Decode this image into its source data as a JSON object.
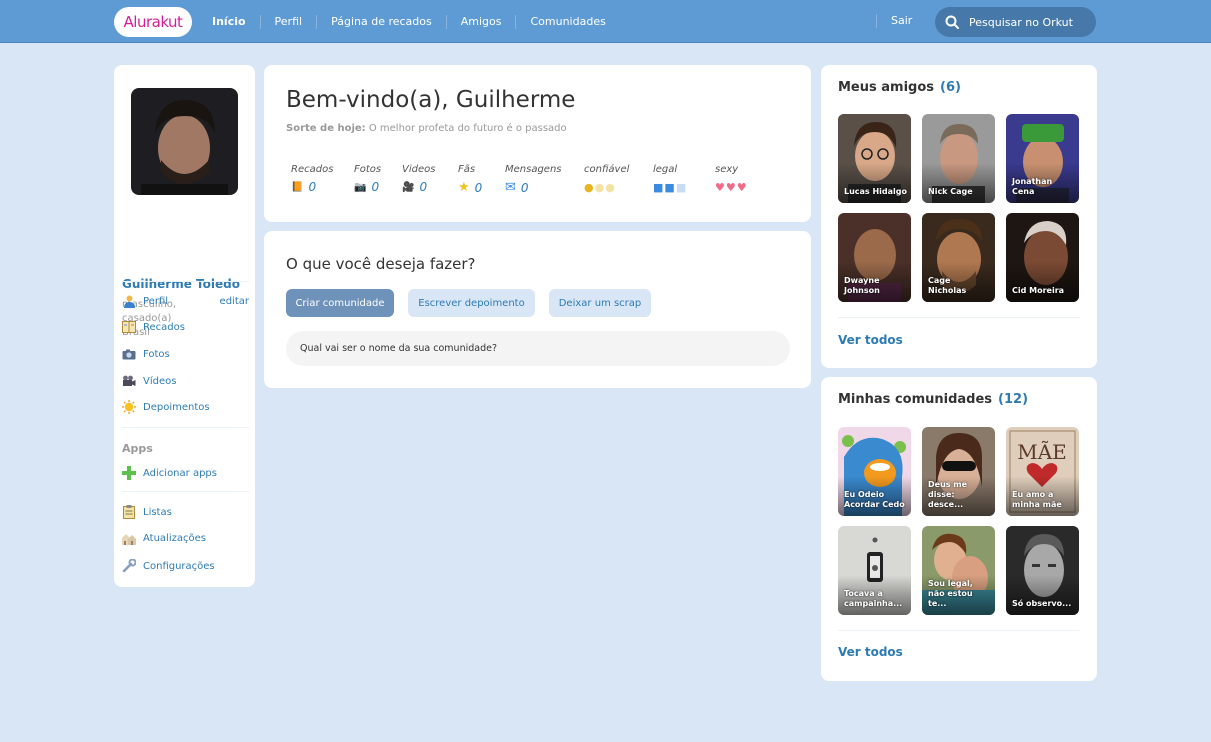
{
  "header": {
    "logo": "Alurakut",
    "nav": [
      "Início",
      "Perfil",
      "Página de recados",
      "Amigos",
      "Comunidades"
    ],
    "logout": "Sair",
    "search_placeholder": "Pesquisar no Orkut"
  },
  "profile": {
    "name": "Guilherme Toledo",
    "info": [
      "masculino,",
      "casado(a)",
      "Brasil"
    ],
    "menu": [
      {
        "label": "Perfil",
        "icon": "person-icon"
      },
      {
        "label": "Recados",
        "icon": "book-icon"
      },
      {
        "label": "Fotos",
        "icon": "camera-icon"
      },
      {
        "label": "Vídeos",
        "icon": "video-camera-icon"
      },
      {
        "label": "Depoimentos",
        "icon": "sun-icon"
      }
    ],
    "edit_label": "editar",
    "apps_title": "Apps",
    "add_apps": "Adicionar apps",
    "extra_menu": [
      {
        "label": "Listas",
        "icon": "clipboard-icon"
      },
      {
        "label": "Atualizações",
        "icon": "houses-icon"
      },
      {
        "label": "Configurações",
        "icon": "wrench-icon"
      }
    ]
  },
  "welcome": {
    "title": "Bem-vindo(a), Guilherme",
    "sorte_label": "Sorte de hoje:",
    "sorte_text": "O melhor profeta do futuro é o passado",
    "stats": [
      {
        "label": "Recados",
        "value": "0",
        "icon": "book-icon"
      },
      {
        "label": "Fotos",
        "value": "0",
        "icon": "camera-icon"
      },
      {
        "label": "Videos",
        "value": "0",
        "icon": "video-camera-icon"
      },
      {
        "label": "Fãs",
        "value": "0",
        "icon": "star-icon"
      },
      {
        "label": "Mensagens",
        "value": "0",
        "icon": "envelope-icon"
      }
    ],
    "ratings": [
      {
        "label": "confiável",
        "icon": "smiley-icon",
        "filled": 1,
        "total": 3
      },
      {
        "label": "legal",
        "icon": "ice-cube-icon",
        "filled": 2,
        "total": 3
      },
      {
        "label": "sexy",
        "icon": "heart-icon",
        "filled": 3,
        "total": 3
      }
    ]
  },
  "actions": {
    "title": "O que você deseja fazer?",
    "buttons": [
      "Criar comunidade",
      "Escrever depoimento",
      "Deixar um scrap"
    ],
    "input_placeholder": "Qual vai ser o nome da sua comunidade?"
  },
  "friends": {
    "title": "Meus amigos",
    "count": "(6)",
    "items": [
      {
        "name": "Lucas Hidalgo",
        "color": "#6b4a36"
      },
      {
        "name": "Nick Cage",
        "color": "#7a6e6a"
      },
      {
        "name": "Jonathan Cena",
        "color": "#4a3f8e"
      },
      {
        "name": "Dwayne Johnson",
        "color": "#5a3a30"
      },
      {
        "name": "Cage Nicholas",
        "color": "#6a4e3a"
      },
      {
        "name": "Cid Moreira",
        "color": "#3a2a22"
      }
    ],
    "see_all": "Ver todos"
  },
  "communities": {
    "title": "Minhas comunidades",
    "count": "(12)",
    "items": [
      {
        "name": "Eu Odeio Acordar Cedo",
        "color": "#6aa0c8"
      },
      {
        "name": "Deus me disse: desce...",
        "color": "#7a6a5a"
      },
      {
        "name": "Eu amo a minha mãe",
        "color": "#c9b8a8"
      },
      {
        "name": "Tocava a campainha...",
        "color": "#9a9a9a"
      },
      {
        "name": "Sou legal, não estou te...",
        "color": "#8a6a4a"
      },
      {
        "name": "Só observo...",
        "color": "#4a4a4a"
      }
    ],
    "see_all": "Ver todos"
  }
}
